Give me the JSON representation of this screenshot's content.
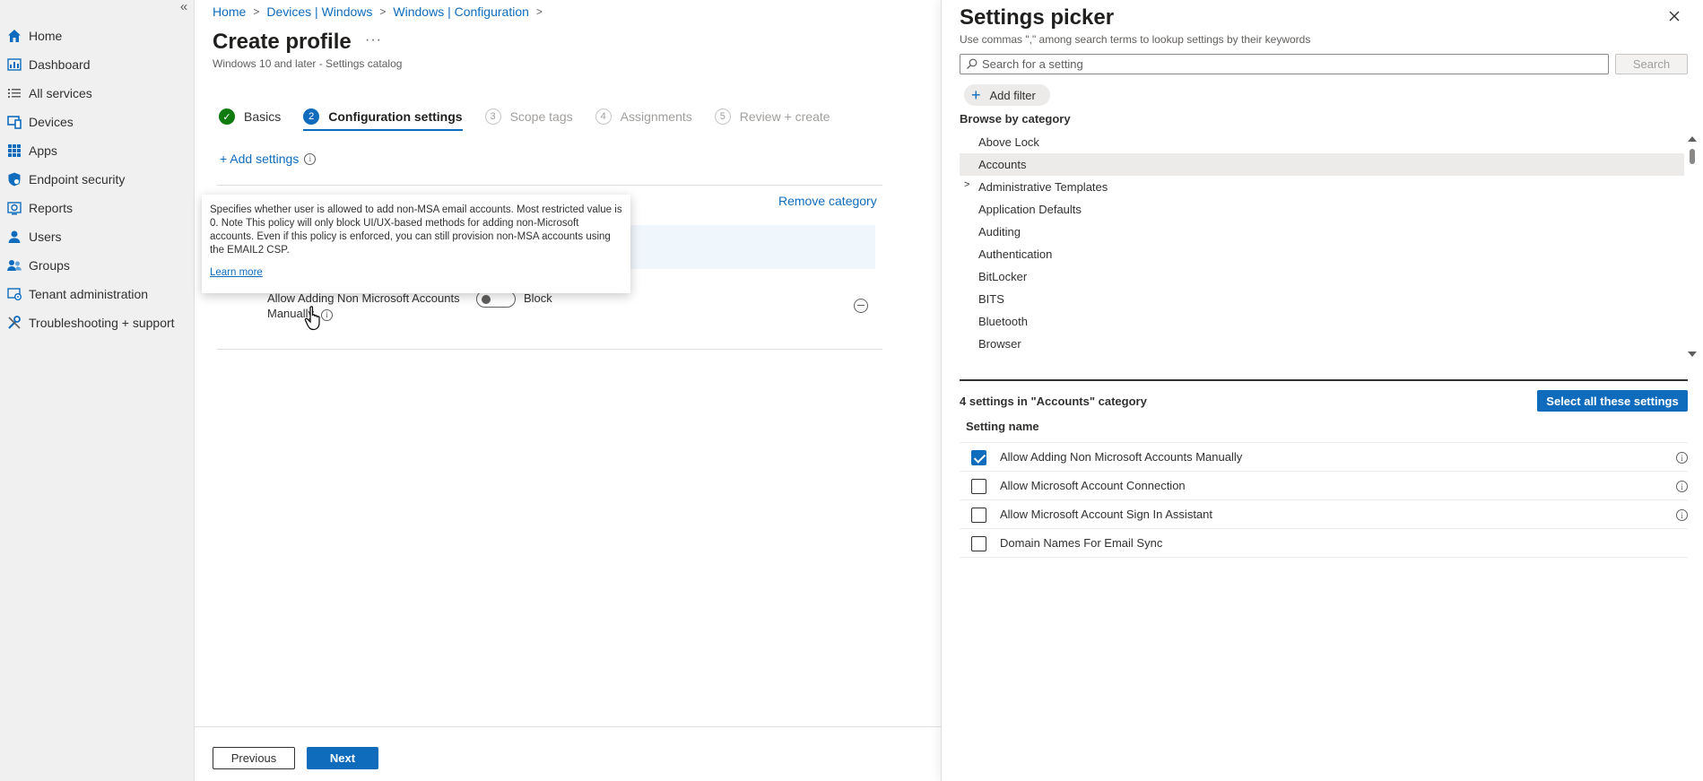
{
  "nav": {
    "collapse_icon": "«",
    "items": [
      {
        "label": "Home",
        "icon": "home-icon"
      },
      {
        "label": "Dashboard",
        "icon": "dashboard-icon"
      },
      {
        "label": "All services",
        "icon": "list-icon"
      },
      {
        "label": "Devices",
        "icon": "devices-icon"
      },
      {
        "label": "Apps",
        "icon": "apps-icon"
      },
      {
        "label": "Endpoint security",
        "icon": "shield-icon"
      },
      {
        "label": "Reports",
        "icon": "reports-icon"
      },
      {
        "label": "Users",
        "icon": "user-icon"
      },
      {
        "label": "Groups",
        "icon": "groups-icon"
      },
      {
        "label": "Tenant administration",
        "icon": "tenant-icon"
      },
      {
        "label": "Troubleshooting + support",
        "icon": "wrench-icon"
      }
    ]
  },
  "breadcrumb": [
    "Home",
    "Devices | Windows",
    "Windows | Configuration"
  ],
  "page": {
    "title": "Create profile",
    "more": "···",
    "subtitle": "Windows 10 and later - Settings catalog"
  },
  "wizard": [
    {
      "num": "✓",
      "label": "Basics",
      "state": "done"
    },
    {
      "num": "2",
      "label": "Configuration settings",
      "state": "active"
    },
    {
      "num": "3",
      "label": "Scope tags",
      "state": "pending"
    },
    {
      "num": "4",
      "label": "Assignments",
      "state": "pending"
    },
    {
      "num": "5",
      "label": "Review + create",
      "state": "pending"
    }
  ],
  "config": {
    "add_settings": "+ Add settings",
    "info_glyph": "i",
    "remove_category": "Remove category",
    "setting_name": "Allow Adding Non Microsoft Accounts Manually",
    "toggle_value": "Block"
  },
  "tooltip": {
    "text": "Specifies whether user is allowed to add non-MSA email accounts. Most restricted value is 0. Note This policy will only block UI/UX-based methods for adding non-Microsoft accounts. Even if this policy is enforced, you can still provision non-MSA accounts using the EMAIL2 CSP.",
    "link": "Learn more"
  },
  "footer": {
    "previous": "Previous",
    "next": "Next"
  },
  "picker": {
    "title": "Settings picker",
    "subtitle": "Use commas \",\" among search terms to lookup settings by their keywords",
    "search_placeholder": "Search for a setting",
    "search_button": "Search",
    "add_filter": "Add filter",
    "browse_label": "Browse by category",
    "categories": [
      {
        "label": "Above Lock",
        "selected": false,
        "expandable": false
      },
      {
        "label": "Accounts",
        "selected": true,
        "expandable": false
      },
      {
        "label": "Administrative Templates",
        "selected": false,
        "expandable": true
      },
      {
        "label": "Application Defaults",
        "selected": false,
        "expandable": false
      },
      {
        "label": "Auditing",
        "selected": false,
        "expandable": false
      },
      {
        "label": "Authentication",
        "selected": false,
        "expandable": false
      },
      {
        "label": "BitLocker",
        "selected": false,
        "expandable": false
      },
      {
        "label": "BITS",
        "selected": false,
        "expandable": false
      },
      {
        "label": "Bluetooth",
        "selected": false,
        "expandable": false
      },
      {
        "label": "Browser",
        "selected": false,
        "expandable": false
      }
    ],
    "count_label": "4 settings in \"Accounts\" category",
    "select_all": "Select all these settings",
    "column_header": "Setting name",
    "settings": [
      {
        "name": "Allow Adding Non Microsoft Accounts Manually",
        "checked": true,
        "info": true
      },
      {
        "name": "Allow Microsoft Account Connection",
        "checked": false,
        "info": true
      },
      {
        "name": "Allow Microsoft Account Sign In Assistant",
        "checked": false,
        "info": true
      },
      {
        "name": "Domain Names For Email Sync",
        "checked": false,
        "info": false
      }
    ]
  },
  "colors": {
    "accent": "#0f6cbd",
    "success": "#107c10",
    "nav_bg": "#f0f0f0"
  }
}
